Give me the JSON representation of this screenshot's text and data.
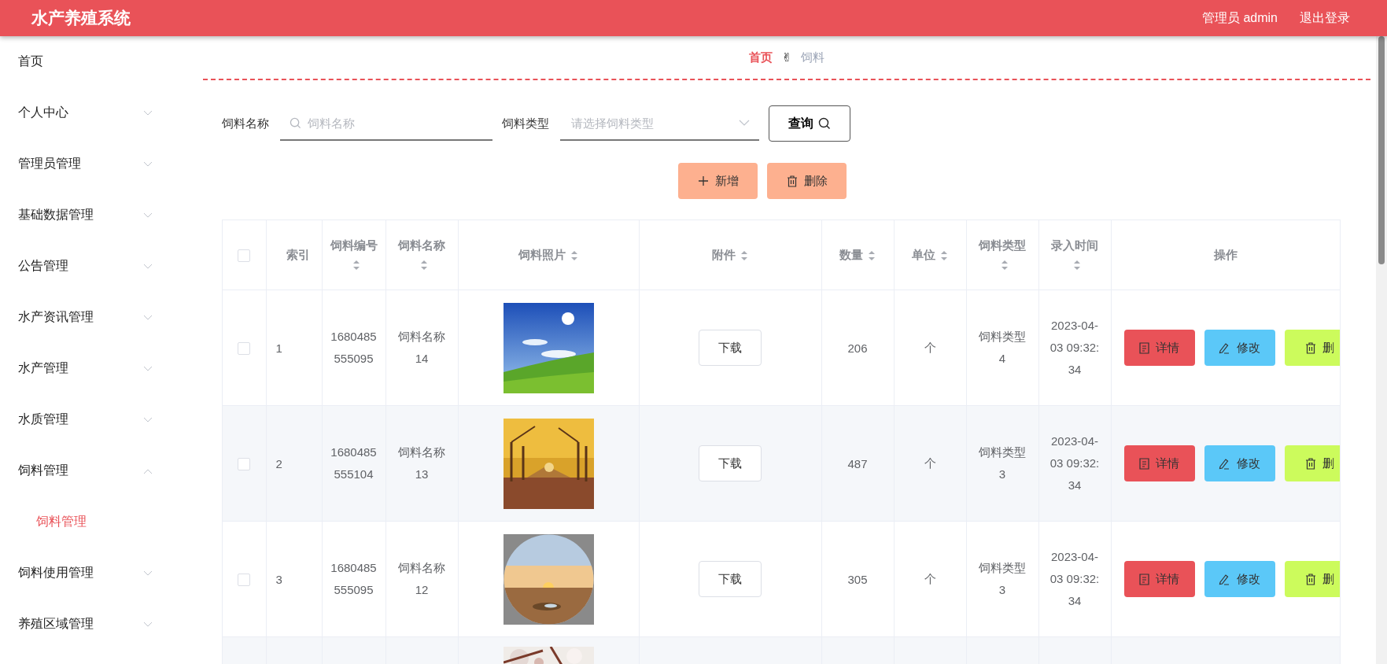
{
  "header": {
    "title": "水产养殖系统",
    "user": "管理员 admin",
    "logout": "退出登录"
  },
  "sidebar": {
    "items": [
      {
        "label": "首页",
        "kind": "link"
      },
      {
        "label": "个人中心",
        "kind": "menu",
        "expanded": false
      },
      {
        "label": "管理员管理",
        "kind": "menu",
        "expanded": false
      },
      {
        "label": "基础数据管理",
        "kind": "menu",
        "expanded": false
      },
      {
        "label": "公告管理",
        "kind": "menu",
        "expanded": false
      },
      {
        "label": "水产资讯管理",
        "kind": "menu",
        "expanded": false
      },
      {
        "label": "水产管理",
        "kind": "menu",
        "expanded": false
      },
      {
        "label": "水质管理",
        "kind": "menu",
        "expanded": false
      },
      {
        "label": "饲料管理",
        "kind": "menu",
        "expanded": true,
        "children": [
          {
            "label": "饲料管理",
            "selected": true
          }
        ]
      },
      {
        "label": "饲料使用管理",
        "kind": "menu",
        "expanded": false
      },
      {
        "label": "养殖区域管理",
        "kind": "menu",
        "expanded": false
      }
    ]
  },
  "breadcrumb": {
    "items": [
      {
        "label": "首页",
        "selected": false
      },
      {
        "label": "饲料",
        "selected": true
      }
    ],
    "separator": "✌"
  },
  "filters": [
    {
      "label": "饲料名称",
      "kind": "search",
      "placeholder": "饲料名称"
    },
    {
      "label": "饲料类型",
      "kind": "select",
      "placeholder": "请选择饲料类型"
    }
  ],
  "query_button": "查询",
  "actions": [
    {
      "label": "新增",
      "kind": "add"
    },
    {
      "label": "删除",
      "kind": "delete"
    }
  ],
  "table": {
    "select_all": {
      "checked": false
    },
    "columns": [
      {
        "label": "索引",
        "sortable": false
      },
      {
        "label": "饲料编号",
        "sortable": true
      },
      {
        "label": "饲料名称",
        "sortable": true
      },
      {
        "label": "饲料照片",
        "sortable": true
      },
      {
        "label": "附件",
        "sortable": true
      },
      {
        "label": "数量",
        "sortable": true
      },
      {
        "label": "单位",
        "sortable": true
      },
      {
        "label": "饲料类型",
        "sortable": true
      },
      {
        "label": "录入时间",
        "sortable": true
      },
      {
        "label": "操作",
        "sortable": false
      }
    ],
    "rows": [
      {
        "checked": false,
        "index": "1",
        "code": "1680485555095",
        "name": "饲料名称14",
        "attachment": "下载",
        "quantity": "206",
        "unit": "个",
        "type": "饲料类型4",
        "time": "2023-04-03 09:32:34",
        "ops": [
          {
            "label": "详情",
            "kind": "detail"
          },
          {
            "label": "修改",
            "kind": "edit"
          },
          {
            "label": "删",
            "kind": "delete"
          }
        ]
      },
      {
        "checked": false,
        "index": "2",
        "code": "1680485555104",
        "name": "饲料名称13",
        "attachment": "下载",
        "quantity": "487",
        "unit": "个",
        "type": "饲料类型3",
        "time": "2023-04-03 09:32:34",
        "ops": [
          {
            "label": "详情",
            "kind": "detail"
          },
          {
            "label": "修改",
            "kind": "edit"
          },
          {
            "label": "删",
            "kind": "delete"
          }
        ]
      },
      {
        "checked": false,
        "index": "3",
        "code": "1680485555095",
        "name": "饲料名称12",
        "attachment": "下载",
        "quantity": "305",
        "unit": "个",
        "type": "饲料类型3",
        "time": "2023-04-03 09:32:34",
        "ops": [
          {
            "label": "详情",
            "kind": "detail"
          },
          {
            "label": "修改",
            "kind": "edit"
          },
          {
            "label": "删",
            "kind": "delete"
          }
        ]
      }
    ]
  }
}
